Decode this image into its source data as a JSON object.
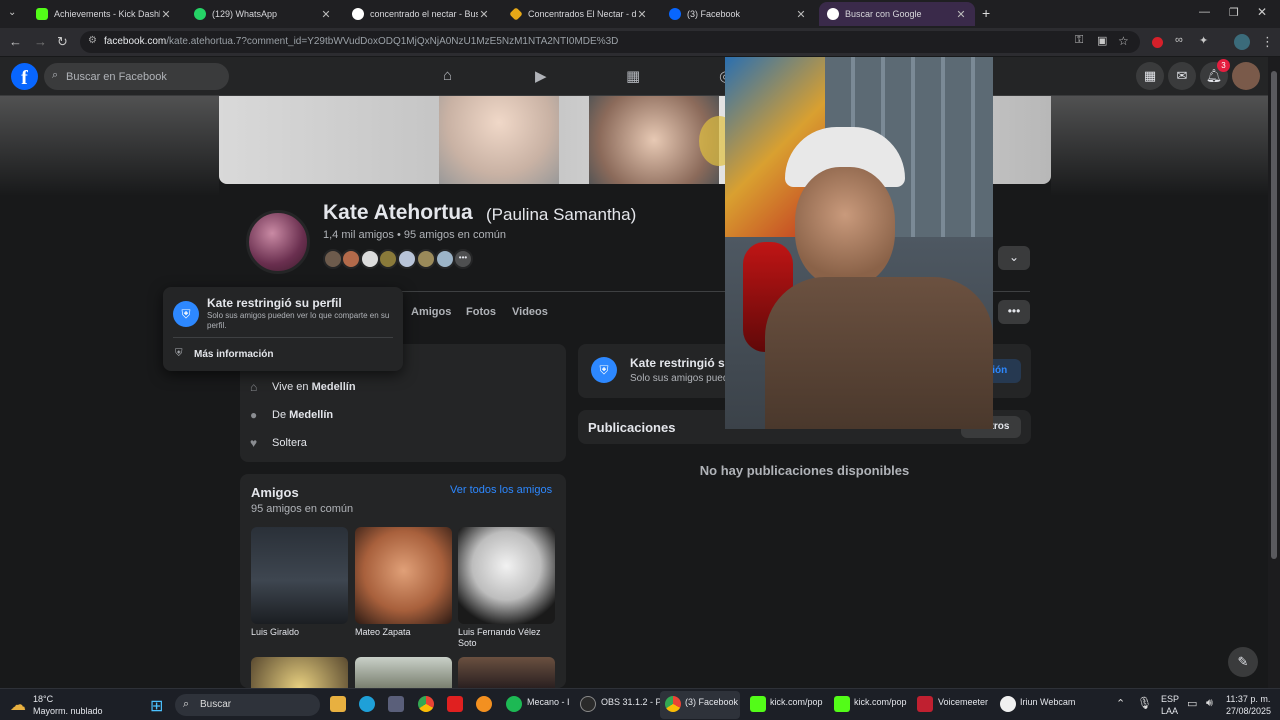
{
  "browser": {
    "tabs": [
      {
        "title": "Achievements - Kick Dashboard",
        "color": "#53fc18"
      },
      {
        "title": "(129) WhatsApp",
        "color": "#25d366"
      },
      {
        "title": "concentrado el nectar - Buscar",
        "color": "#4285f4"
      },
      {
        "title": "Concentrados El Nectar - depo",
        "color": "#e6a817"
      },
      {
        "title": "(3) Facebook",
        "color": "#0866ff"
      },
      {
        "title": "Buscar con Google",
        "color": "#4285f4"
      }
    ],
    "new_tab": "+",
    "url_domain": "facebook.com",
    "url_path": "/kate.atehortua.7?comment_id=Y29tbWVudDoxODQ1MjQxNjA0NzU1MzE5NzM1NTA2NTI0MDE%3D"
  },
  "fb": {
    "logo": "f",
    "search_placeholder": "Buscar en Facebook",
    "notification_count": "3"
  },
  "profile": {
    "name": "Kate Atehortua",
    "alt_name": "(Paulina Samantha)",
    "friends_line": "1,4 mil amigos • 95 amigos en común",
    "tabs": [
      "Amigos",
      "Fotos",
      "Videos"
    ],
    "more": "•••"
  },
  "popup": {
    "title": "Kate restringió su perfil",
    "desc": "Solo sus amigos pueden ver lo que comparte en su perfil.",
    "more_info": "Más información"
  },
  "intro": {
    "lives_prefix": "Vive en ",
    "lives_city": "Medellín",
    "from_prefix": "De ",
    "from_city": "Medellín",
    "status": "Soltera"
  },
  "restricted_card": {
    "title": "Kate restringió su p",
    "desc": "Solo sus amigos pued",
    "button": "ción"
  },
  "friends": {
    "title": "Amigos",
    "subtitle": "95 amigos en común",
    "see_all": "Ver todos los amigos",
    "people": [
      {
        "name": "Luis Giraldo"
      },
      {
        "name": "Mateo Zapata"
      },
      {
        "name": "Luis Fernando Vélez Soto"
      }
    ]
  },
  "posts": {
    "title": "Publicaciones",
    "filters": "iltros",
    "empty": "No hay publicaciones disponibles"
  },
  "taskbar": {
    "weather_temp": "18°C",
    "weather_desc": "Mayorm. nublado",
    "search": "Buscar",
    "apps": [
      {
        "label": "Mecano - I"
      },
      {
        "label": "OBS 31.1.2 - Pr"
      },
      {
        "label": "(3) Facebook"
      },
      {
        "label": "kick.com/pop"
      },
      {
        "label": "kick.com/pop"
      },
      {
        "label": "Voicemeeter"
      },
      {
        "label": "Iriun Webcam"
      }
    ],
    "lang": "ESP",
    "lang2": "LAA",
    "time": "11:37 p. m.",
    "date": "27/08/2025"
  }
}
